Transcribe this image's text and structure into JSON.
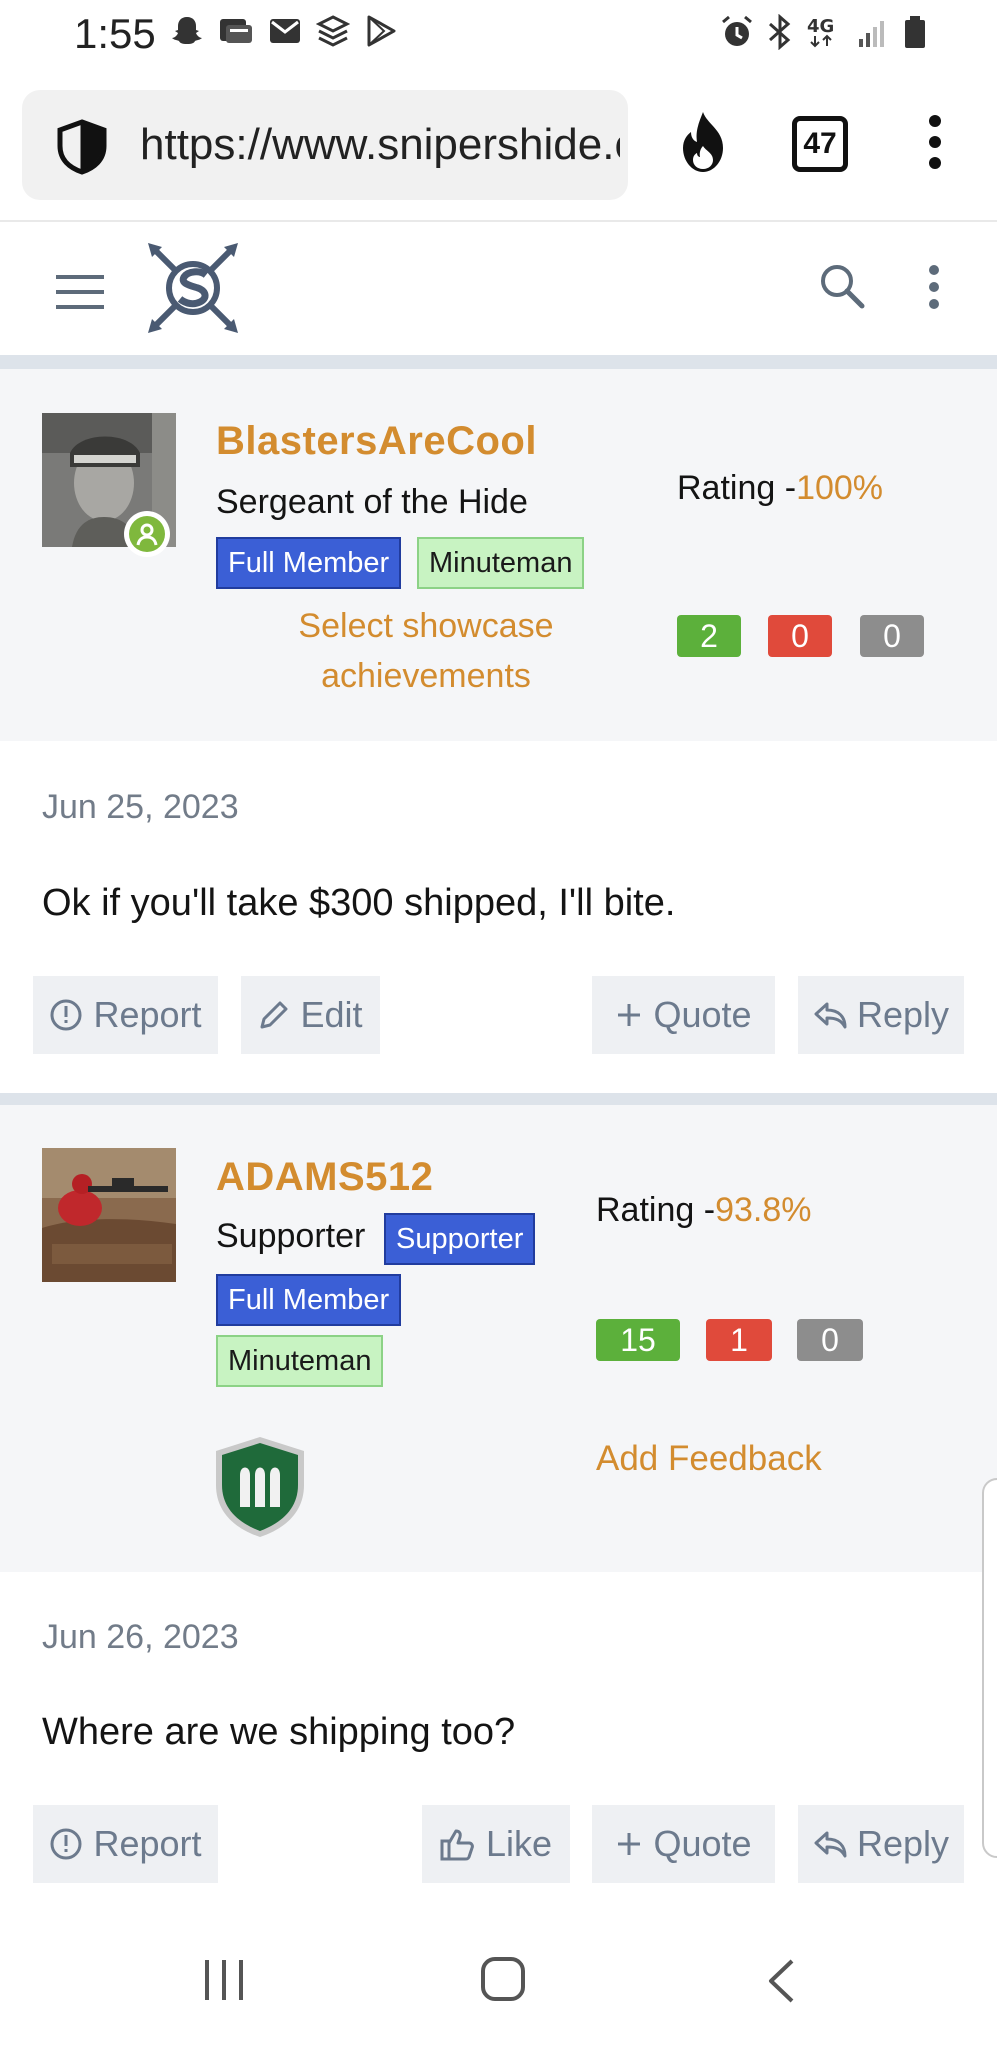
{
  "status_bar": {
    "time": "1:55",
    "network": "4G"
  },
  "browser": {
    "url": "https://www.snipershide.com",
    "tab_count": "47"
  },
  "posts": [
    {
      "user": {
        "name": "BlastersAreCool",
        "title": "Sergeant of the Hide",
        "badges": [
          "Full Member",
          "Minuteman"
        ],
        "showcase_line1": "Select showcase",
        "showcase_line2": "achievements",
        "rating_label": "Rating -",
        "rating_value": "100%",
        "feedback": {
          "positive": "2",
          "negative": "0",
          "neutral": "0"
        }
      },
      "date": "Jun 25, 2023",
      "text": "Ok if you'll take $300 shipped, I'll bite.",
      "actions": {
        "report": "Report",
        "edit": "Edit",
        "quote": "Quote",
        "reply": "Reply"
      }
    },
    {
      "user": {
        "name": "ADAMS512",
        "title": "Supporter",
        "badges": [
          "Supporter",
          "Full Member",
          "Minuteman"
        ],
        "rating_label": "Rating -",
        "rating_value": "93.8%",
        "feedback": {
          "positive": "15",
          "negative": "1",
          "neutral": "0"
        },
        "add_feedback": "Add Feedback"
      },
      "date": "Jun 26, 2023",
      "text": "Where are we shipping too?",
      "actions": {
        "report": "Report",
        "like": "Like",
        "quote": "Quote",
        "reply": "Reply"
      }
    }
  ],
  "colors": {
    "accent": "#d38c2f",
    "badge_blue": "#3b5fd6",
    "badge_green": "#c8f3c2",
    "feedback_positive": "#5cb03b",
    "feedback_negative": "#e04a3b",
    "feedback_neutral": "#8d8d8d"
  }
}
